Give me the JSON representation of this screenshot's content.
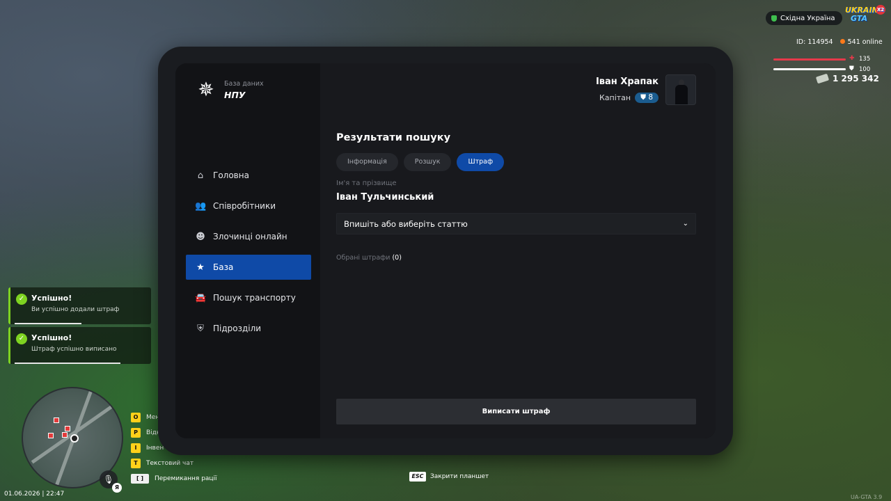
{
  "hud": {
    "region": "Східна Україна",
    "logo_line1": "UKRAIN",
    "logo_line2": "GTA",
    "logo_badge": "X2",
    "player_id": "ID: 114954",
    "online": "541 online",
    "health": "135",
    "armor": "100",
    "money": "1 295 342",
    "datetime": "01.06.2026 | 22:47",
    "voice_badge": "Я",
    "version": "UA-GTA 3.9"
  },
  "toasts": [
    {
      "title": "Успішно!",
      "message": "Ви успішно додали штраф",
      "progress": 0.49
    },
    {
      "title": "Успішно!",
      "message": "Штраф успішно виписано",
      "progress": 0.76
    }
  ],
  "key_hints": [
    {
      "key": "O",
      "label": "Мен"
    },
    {
      "key": "P",
      "label": "Відк"
    },
    {
      "key": "I",
      "label": "Інвен"
    },
    {
      "key": "T",
      "label": "Текстовий чат"
    },
    {
      "key": "[ ]",
      "label": "Перемикання рації"
    }
  ],
  "tablet": {
    "brand_sub": "База даних",
    "brand_name": "НПУ",
    "nav": [
      {
        "label": "Головна",
        "icon": "home-icon"
      },
      {
        "label": "Співробітники",
        "icon": "users-icon"
      },
      {
        "label": "Злочинці онлайн",
        "icon": "skull-icon"
      },
      {
        "label": "База",
        "icon": "star-icon",
        "active": true
      },
      {
        "label": "Пошук транспорту",
        "icon": "car-icon"
      },
      {
        "label": "Підрозділи",
        "icon": "shield-icon"
      }
    ],
    "profile": {
      "name": "Іван Храпак",
      "rank": "Капітан",
      "level": "8"
    },
    "results_title": "Результати пошуку",
    "tabs": [
      "Інформація",
      "Розшук",
      "Штраф"
    ],
    "active_tab": "Штраф",
    "field_label": "Ім'я та прізвище",
    "field_value": "Іван Тульчинський",
    "select_placeholder": "Впишіть або виберіть статтю",
    "chosen_label": "Обрані штрафи",
    "chosen_count": "(0)",
    "submit_label": "Виписати штраф"
  },
  "esc_hint": {
    "key": "ESC",
    "label": "Закрити планшет"
  }
}
